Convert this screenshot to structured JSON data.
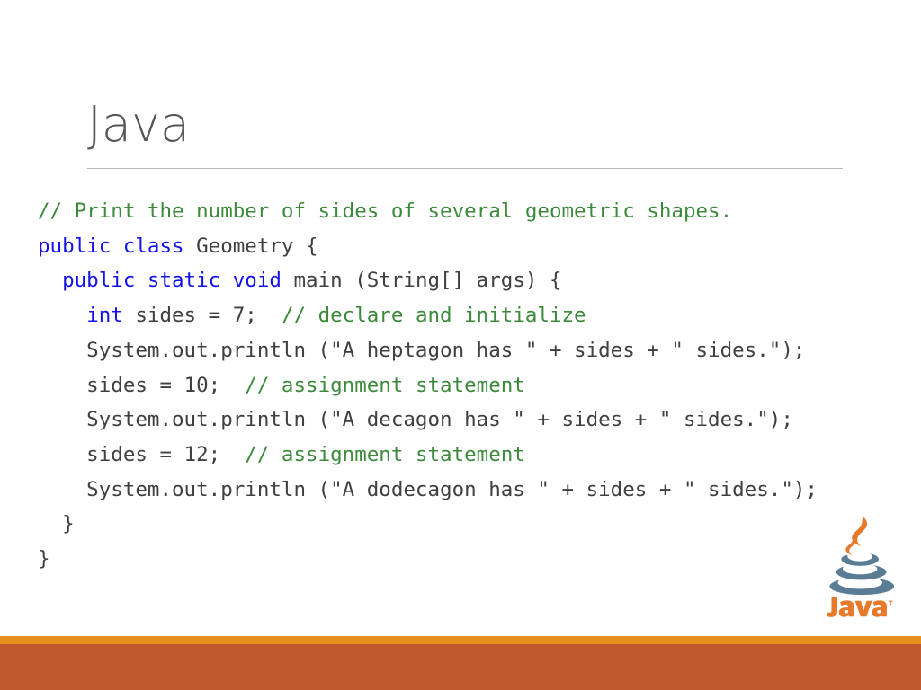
{
  "slide": {
    "title": "Java",
    "code_lines": [
      {
        "id": "line-1",
        "segments": [
          {
            "text": "// Print the number of sides of several geometric shapes.",
            "type": "comment"
          }
        ]
      },
      {
        "id": "line-2",
        "segments": [
          {
            "text": "public class ",
            "type": "keyword"
          },
          {
            "text": "Geometry {",
            "type": "plain"
          }
        ]
      },
      {
        "id": "line-3",
        "segments": [
          {
            "text": "  ",
            "type": "plain"
          },
          {
            "text": "public static void ",
            "type": "keyword"
          },
          {
            "text": "main (String[] args) {",
            "type": "plain"
          }
        ]
      },
      {
        "id": "line-4",
        "segments": [
          {
            "text": "    ",
            "type": "plain"
          },
          {
            "text": "int ",
            "type": "keyword"
          },
          {
            "text": "sides = 7;  ",
            "type": "plain"
          },
          {
            "text": "// declare and initialize",
            "type": "comment"
          }
        ]
      },
      {
        "id": "line-5",
        "segments": [
          {
            "text": "    System.out.println (\"A heptagon has \" + sides + \" sides.\");",
            "type": "plain"
          }
        ]
      },
      {
        "id": "line-6",
        "segments": [
          {
            "text": "    sides = 10;  ",
            "type": "plain"
          },
          {
            "text": "// assignment statement",
            "type": "comment"
          }
        ]
      },
      {
        "id": "line-7",
        "segments": [
          {
            "text": "    System.out.println (\"A decagon has \" + sides + \" sides.\");",
            "type": "plain"
          }
        ]
      },
      {
        "id": "line-8",
        "segments": [
          {
            "text": "    sides = 12;  ",
            "type": "plain"
          },
          {
            "text": "// assignment statement",
            "type": "comment"
          }
        ]
      },
      {
        "id": "line-9",
        "segments": [
          {
            "text": "    System.out.println (\"A dodecagon has \" + sides + \" sides.\");",
            "type": "plain"
          }
        ]
      },
      {
        "id": "line-10",
        "segments": [
          {
            "text": "  }",
            "type": "plain"
          }
        ]
      },
      {
        "id": "line-11",
        "segments": [
          {
            "text": "}",
            "type": "plain"
          }
        ]
      }
    ]
  },
  "logo": {
    "name": "java-logo",
    "wordmark": "Java",
    "trademark": "™"
  },
  "colors": {
    "comment": "#3c8a3c",
    "keyword": "#1414e6",
    "code_text": "#404040",
    "title": "#575757",
    "rule": "#b6b6b6",
    "band_accent": "#e8901f",
    "band_main": "#c05a2e",
    "logo_orange": "#e7792b",
    "logo_cup": "#5a7d95"
  }
}
